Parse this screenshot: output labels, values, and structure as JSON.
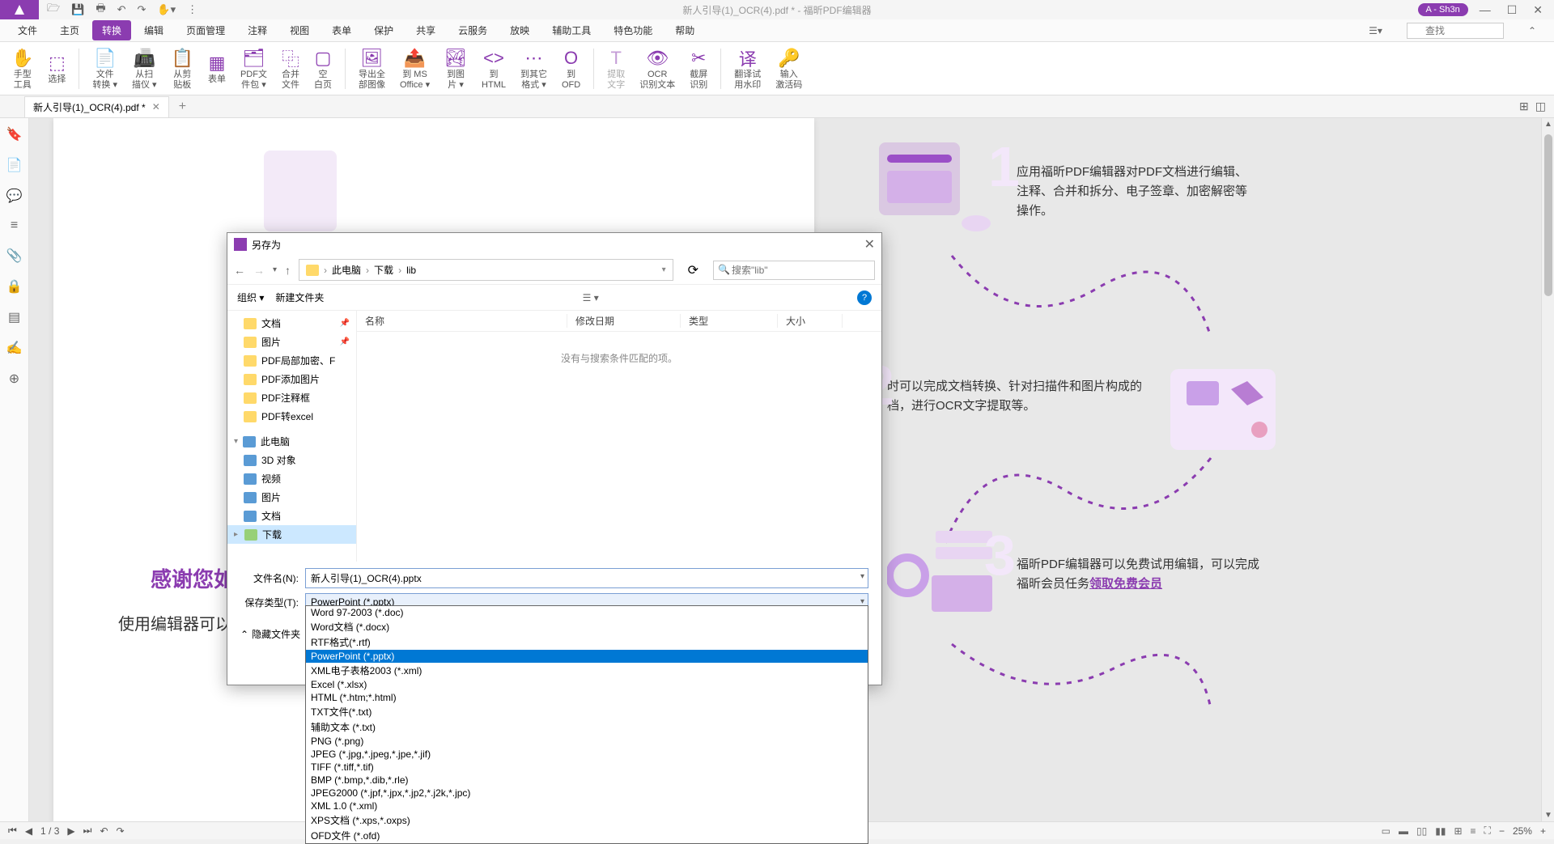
{
  "titlebar": {
    "title": "新人引导(1)_OCR(4).pdf * - 福昕PDF编辑器",
    "user": "A - Sh3n"
  },
  "menu": {
    "items": [
      "文件",
      "主页",
      "转换",
      "编辑",
      "页面管理",
      "注释",
      "视图",
      "表单",
      "保护",
      "共享",
      "云服务",
      "放映",
      "辅助工具",
      "特色功能",
      "帮助"
    ],
    "active_index": 2,
    "search_placeholder": "查找"
  },
  "ribbon": [
    {
      "label": "手型\n工具",
      "icon": "✋"
    },
    {
      "label": "选择",
      "icon": "⬚"
    },
    {
      "label": "文件\n转换 ▾",
      "icon": "📄"
    },
    {
      "label": "从扫\n描仪 ▾",
      "icon": "📠"
    },
    {
      "label": "从剪\n贴板",
      "icon": "📋"
    },
    {
      "label": "表单",
      "icon": "▦"
    },
    {
      "label": "PDF文\n件包 ▾",
      "icon": "🗂"
    },
    {
      "label": "合并\n文件",
      "icon": "⿻"
    },
    {
      "label": "空\n白页",
      "icon": "▢"
    },
    {
      "label": "导出全\n部图像",
      "icon": "🖼"
    },
    {
      "label": "到 MS\nOffice ▾",
      "icon": "📤"
    },
    {
      "label": "到图\n片 ▾",
      "icon": "🏞"
    },
    {
      "label": "到\nHTML",
      "icon": "<>"
    },
    {
      "label": "到其它\n格式 ▾",
      "icon": "⋯"
    },
    {
      "label": "到\nOFD",
      "icon": "O"
    },
    {
      "label": "提取\n文字",
      "icon": "T"
    },
    {
      "label": "OCR\n识别文本",
      "icon": "👁"
    },
    {
      "label": "截屏\n识别",
      "icon": "✂"
    },
    {
      "label": "翻译试\n用水印",
      "icon": "译"
    },
    {
      "label": "输入\n激活码",
      "icon": "🔑"
    }
  ],
  "tab": {
    "name": "新人引导(1)_OCR(4).pdf *"
  },
  "dialog": {
    "title": "另存为",
    "breadcrumb": [
      "此电脑",
      "下载",
      "lib"
    ],
    "search_placeholder": "搜索\"lib\"",
    "organize": "组织 ▾",
    "newfolder": "新建文件夹",
    "tree": [
      {
        "label": "文档",
        "icon": "folder",
        "pin": "📌"
      },
      {
        "label": "图片",
        "icon": "folder",
        "pin": "📌"
      },
      {
        "label": "PDF局部加密、F",
        "icon": "folder"
      },
      {
        "label": "PDF添加图片",
        "icon": "folder"
      },
      {
        "label": "PDF注释框",
        "icon": "folder"
      },
      {
        "label": "PDF转excel",
        "icon": "folder"
      },
      {
        "label": "此电脑",
        "icon": "pc",
        "indent": 0
      },
      {
        "label": "3D 对象",
        "icon": "pc"
      },
      {
        "label": "视频",
        "icon": "pc"
      },
      {
        "label": "图片",
        "icon": "pc"
      },
      {
        "label": "文档",
        "icon": "pc"
      },
      {
        "label": "下载",
        "icon": "dl",
        "selected": true
      }
    ],
    "columns": [
      "名称",
      "修改日期",
      "类型",
      "大小"
    ],
    "empty_msg": "没有与搜索条件匹配的项。",
    "filename_label": "文件名(N):",
    "filename_value": "新人引导(1)_OCR(4).pptx",
    "filetype_label": "保存类型(T):",
    "filetype_value": "PowerPoint (*.pptx)",
    "hide_folders": "隐藏文件夹",
    "formats": [
      "Word 97-2003 (*.doc)",
      "Word文档 (*.docx)",
      "RTF格式(*.rtf)",
      "PowerPoint (*.pptx)",
      "XML电子表格2003 (*.xml)",
      "Excel (*.xlsx)",
      "HTML (*.htm;*.html)",
      "TXT文件(*.txt)",
      "辅助文本 (*.txt)",
      "PNG (*.png)",
      "JPEG (*.jpg,*.jpeg,*.jpe,*.jif)",
      "TIFF (*.tiff,*.tif)",
      "BMP (*.bmp,*.dib,*.rle)",
      "JPEG2000 (*.jpf,*.jpx,*.jp2,*.j2k,*.jpc)",
      "XML 1.0 (*.xml)",
      "XPS文档 (*.xps,*.oxps)",
      "OFD文件 (*.ofd)"
    ],
    "format_highlight": 3
  },
  "doc": {
    "text1": "应用福昕PDF编辑器对PDF文档进行编辑、注释、合并和拆分、电子签章、加密解密等操作。",
    "text2": "时可以完成文档转换、针对扫描件和图片构成的档，进行OCR文字提取等。",
    "text3a": "福昕PDF编辑器可以免费试用编辑，可以完成福昕会员任务",
    "text3b": "领取免费会员",
    "thanks": "感谢您如全球",
    "help": "使用编辑器可以帮助"
  },
  "status": {
    "page": "1 / 3",
    "zoom": "25%"
  }
}
